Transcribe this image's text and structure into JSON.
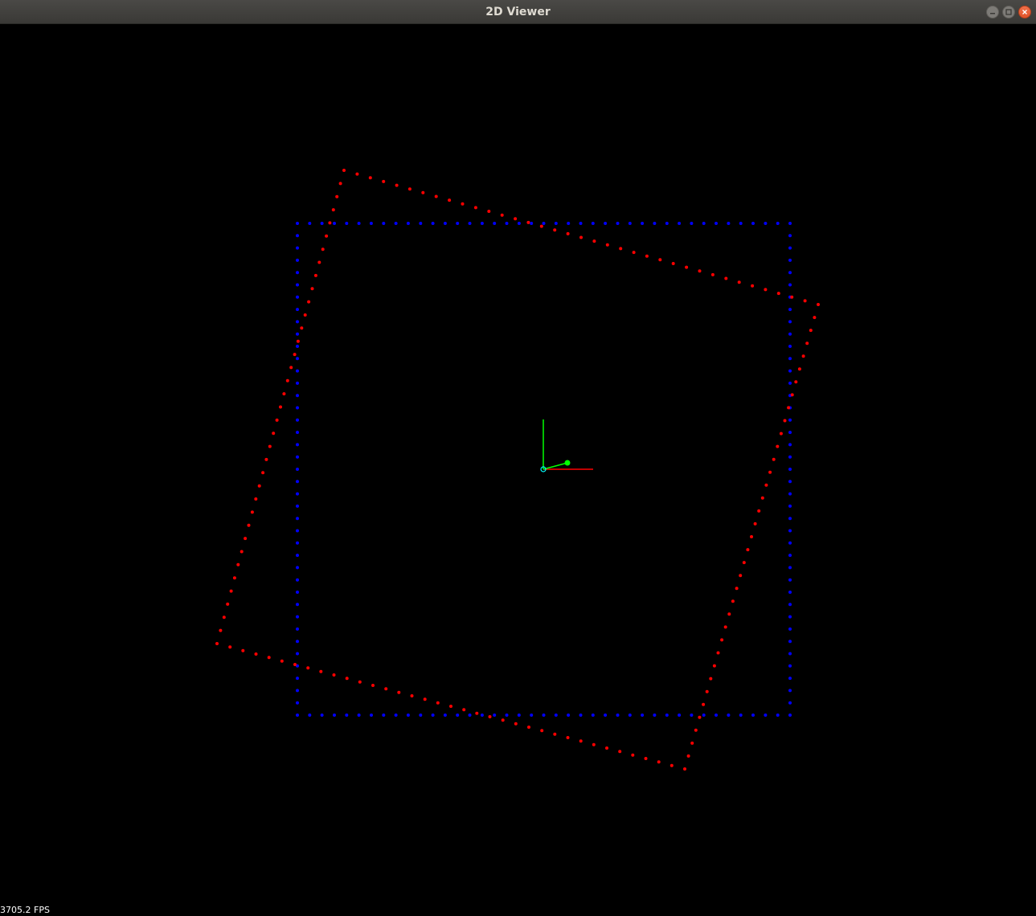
{
  "window": {
    "title": "2D Viewer",
    "buttons": {
      "minimize": "minimize-icon",
      "maximize": "maximize-icon",
      "close": "close-icon"
    }
  },
  "viewer": {
    "background_color": "#000000",
    "fps_text": "3705.2 FPS",
    "reference_points_color": "#0000ff",
    "transformed_points_color": "#ff0000",
    "axes": {
      "x_axis_color": "#ff0000",
      "y_axis_color": "#00ff00",
      "origin_color": "#00ffff",
      "heading_color": "#00ff00"
    }
  }
}
